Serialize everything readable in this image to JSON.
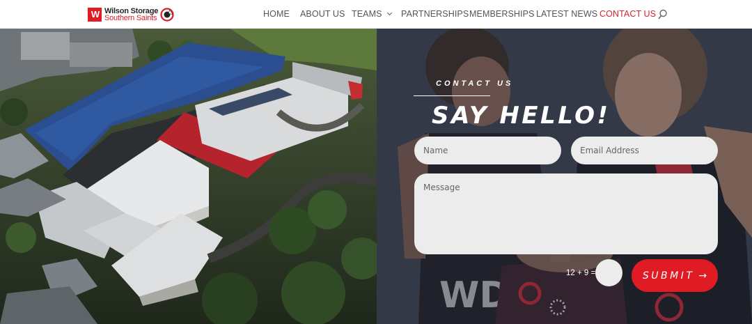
{
  "brand": {
    "line1": "Wilson Storage",
    "line2": "Southern Saints",
    "accent": "#e01b24"
  },
  "nav": {
    "items": [
      {
        "label": "HOME"
      },
      {
        "label": "ABOUT US"
      },
      {
        "label": "TEAMS",
        "has_dropdown": true
      },
      {
        "label": "PARTNERSHIPS"
      },
      {
        "label": "MEMBERSHIPS"
      },
      {
        "label": "LATEST NEWS"
      },
      {
        "label": "CONTACT US",
        "active": true
      }
    ],
    "search_icon": "search-icon"
  },
  "contact": {
    "kicker": "CONTACT US",
    "heading": "SAY HELLO!",
    "name_placeholder": "Name",
    "email_placeholder": "Email Address",
    "message_placeholder": "Message",
    "captcha_question": "12 + 9 =",
    "submit_label": "SUBMIT",
    "submit_arrow": "→"
  }
}
